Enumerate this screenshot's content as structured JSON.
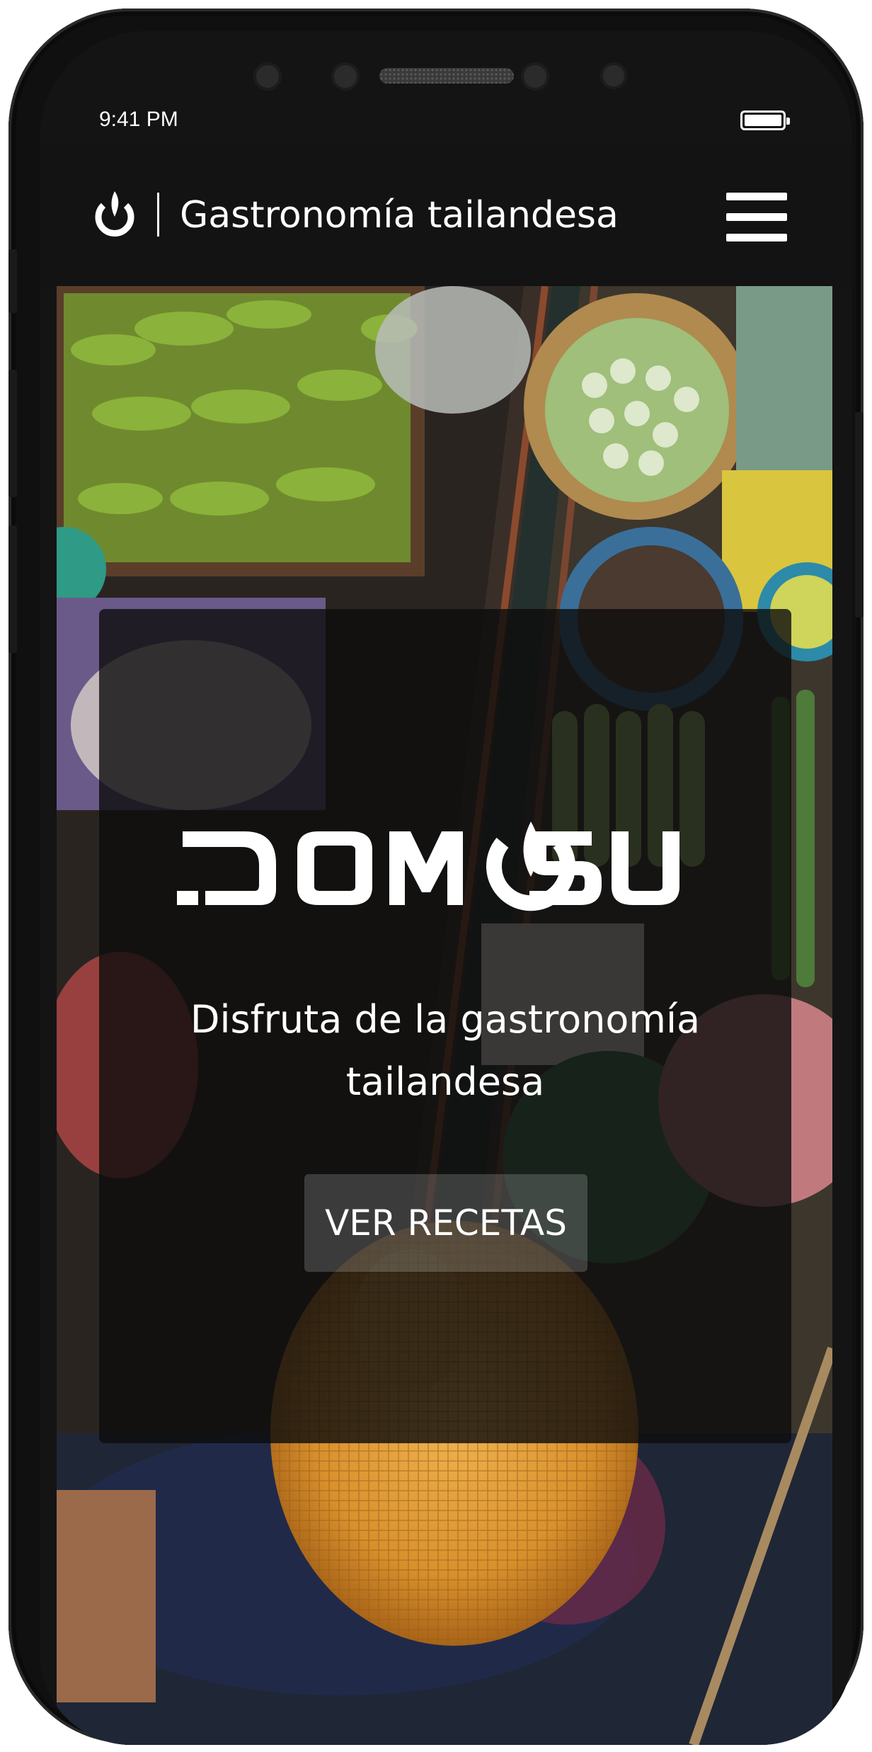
{
  "status_bar": {
    "time": "9:41 PM",
    "battery_icon": "battery-full-icon"
  },
  "header": {
    "logo_icon": "power-flame-logo-icon",
    "title": "Gastronomía tailandesa",
    "menu_icon": "hamburger-menu-icon"
  },
  "hero": {
    "background": "floating-market-photo",
    "brand_name": "DOM SUM",
    "tagline_line1": "Disfruta de la gastronomía",
    "tagline_line2": "tailandesa",
    "cta_label": "VER RECETAS"
  },
  "colors": {
    "header_bg": "#131313",
    "overlay": "rgba(12,12,12,0.80)",
    "text": "#ffffff",
    "hat": "#e8a33c"
  }
}
